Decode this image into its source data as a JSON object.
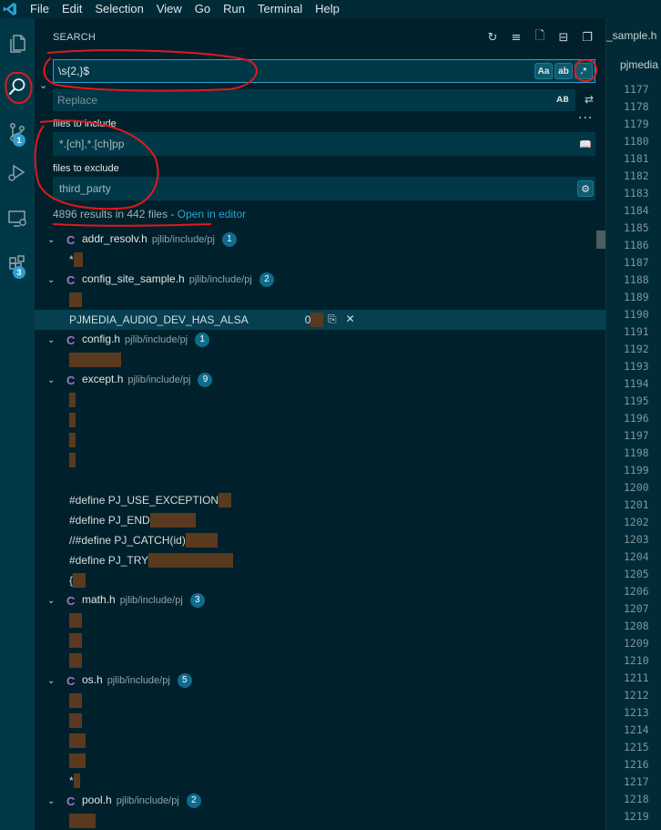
{
  "menu": [
    "File",
    "Edit",
    "Selection",
    "View",
    "Go",
    "Run",
    "Terminal",
    "Help"
  ],
  "activity_bar": [
    {
      "icon": "files-icon"
    },
    {
      "icon": "search-icon",
      "active": true
    },
    {
      "icon": "source-control-icon",
      "badge": "1"
    },
    {
      "icon": "run-debug-icon"
    },
    {
      "icon": "remote-explorer-icon"
    },
    {
      "icon": "extensions-icon",
      "badge": "3"
    }
  ],
  "sidebar": {
    "title": "SEARCH",
    "search_value": "\\s{2,}$",
    "search_opts": [
      "Aa",
      "ab",
      ".*"
    ],
    "replace_placeholder": "Replace",
    "replace_opt": "AB",
    "include_label": "files to include",
    "include_value": "*.[ch],*.[ch]pp",
    "exclude_label": "files to exclude",
    "exclude_value": "third_party",
    "summary_text": "4896 results in 442 files - ",
    "summary_link": "Open in editor"
  },
  "results": [
    {
      "name": "addr_resolv.h",
      "path": "pjlib/include/pj",
      "count": "1",
      "matches": [
        {
          "prefix": "*",
          "hl": 10
        }
      ]
    },
    {
      "name": "config_site_sample.h",
      "path": "pjlib/include/pj",
      "count": "2",
      "matches": [
        {
          "prefix": "",
          "hl": 14
        },
        {
          "prefix": "PJMEDIA_AUDIO_DEV_HAS_ALSA",
          "suffix": "0",
          "hl": 14,
          "selected": true
        }
      ]
    },
    {
      "name": "config.h",
      "path": "pjlib/include/pj",
      "count": "1",
      "matches": [
        {
          "prefix": "",
          "hl": 57
        }
      ]
    },
    {
      "name": "except.h",
      "path": "pjlib/include/pj",
      "count": "9",
      "matches": [
        {
          "prefix": "",
          "hl": 7
        },
        {
          "prefix": "",
          "hl": 7
        },
        {
          "prefix": "",
          "hl": 7
        },
        {
          "prefix": "",
          "hl": 7
        },
        {
          "prefix": "",
          "hl": 0
        },
        {
          "prefix": "#define PJ_USE_EXCEPTION",
          "hl": 14
        },
        {
          "prefix": "#define PJ_END",
          "hl": 50
        },
        {
          "prefix": "//#define PJ_CATCH(id)",
          "hl": 35
        },
        {
          "prefix": "#define PJ_TRY",
          "hl": 93
        },
        {
          "prefix": "{",
          "hl": 14
        }
      ]
    },
    {
      "name": "math.h",
      "path": "pjlib/include/pj",
      "count": "3",
      "matches": [
        {
          "prefix": "",
          "hl": 14
        },
        {
          "prefix": "",
          "hl": 14
        },
        {
          "prefix": "",
          "hl": 14
        }
      ]
    },
    {
      "name": "os.h",
      "path": "pjlib/include/pj",
      "count": "5",
      "matches": [
        {
          "prefix": "",
          "hl": 14
        },
        {
          "prefix": "",
          "hl": 14
        },
        {
          "prefix": "",
          "hl": 18
        },
        {
          "prefix": "",
          "hl": 18
        },
        {
          "prefix": "*",
          "hl": 7
        }
      ]
    },
    {
      "name": "pool.h",
      "path": "pjlib/include/pj",
      "count": "2",
      "matches": [
        {
          "prefix": "",
          "hl": 29
        },
        {
          "prefix": "",
          "hl": 14
        }
      ]
    }
  ],
  "editor": {
    "tab": "_sample.h",
    "breadcrumb": "pjmedia",
    "line_start": 1177,
    "line_end": 1219
  },
  "colors": {
    "accent": "#2aa1d3",
    "badge": "#0f6c8c",
    "annotation": "#e0191f",
    "match_highlight": "#5a3a1f"
  }
}
